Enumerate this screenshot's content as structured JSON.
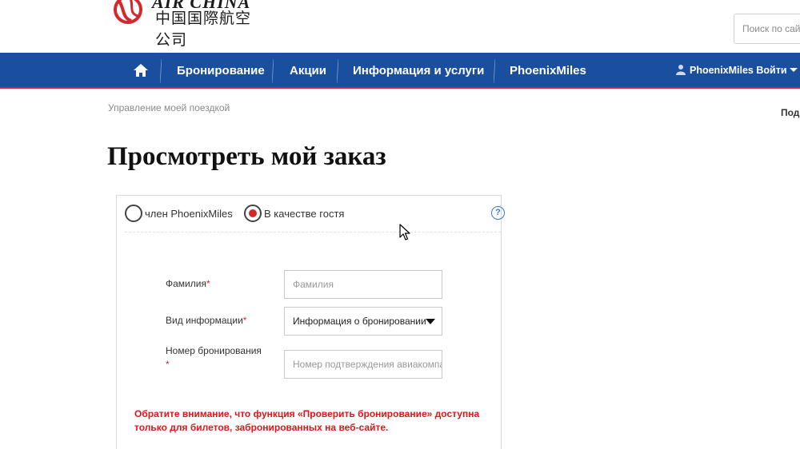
{
  "header": {
    "logo_en": "AIR CHINA",
    "logo_cn": "中国国際航空公司",
    "search_placeholder": "Поиск по сайту"
  },
  "nav": {
    "items": [
      {
        "label": "Бронирование"
      },
      {
        "label": "Акции"
      },
      {
        "label": "Информация и услуги"
      },
      {
        "label": "PhoenixMiles"
      }
    ],
    "user_label": "PhoenixMiles Войти"
  },
  "breadcrumb": "Управление моей поездкой",
  "right_cut_text": "Под",
  "page_title": "Просмотреть мой заказ",
  "form": {
    "radio_member": "член PhoenixMiles",
    "radio_guest": "В качестве гостя",
    "help": "?",
    "surname_label": "Фамилия",
    "surname_placeholder": "Фамилия",
    "info_type_label": "Вид информации",
    "info_type_value": "Информация о бронировании",
    "booking_label": "Номер бронирования",
    "booking_placeholder": "Номер подтверждения авиакомпании",
    "required_mark": "*",
    "notice": "Обратите внимание, что функция «Проверить бронирование» доступна только для билетов, забронированных на веб-сайте."
  },
  "colors": {
    "nav_blue": "#1a4fa0",
    "accent_red": "#d4282c"
  }
}
